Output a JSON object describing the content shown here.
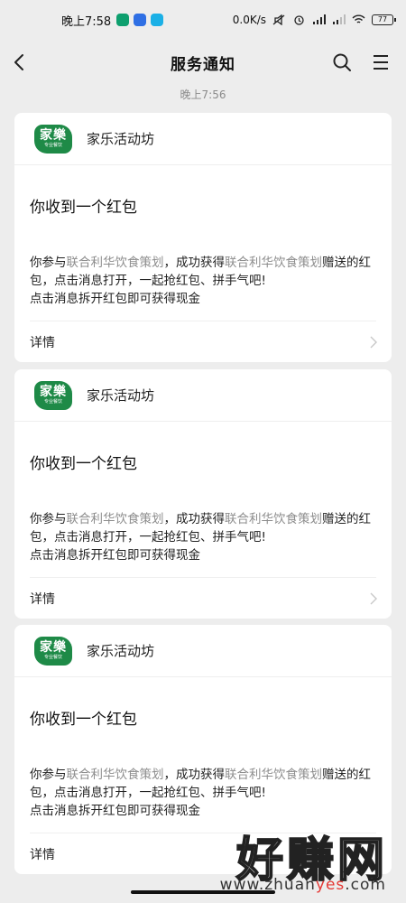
{
  "status_bar": {
    "time": "晚上7:58",
    "network_speed": "0.0K/s",
    "battery": "77",
    "app_icon_colors": [
      "#0e9f6e",
      "#2f6fe4",
      "#1bb0e6"
    ]
  },
  "nav": {
    "title": "服务通知",
    "back_icon": "chevron-left-icon",
    "search_icon": "search-icon",
    "menu_icon": "menu-icon"
  },
  "timestamp": "晚上7:56",
  "cards": [
    {
      "logo_main": "家樂",
      "logo_sub": "专业餐饮",
      "sender": "家乐活动坊",
      "title": "你收到一个红包",
      "body_prefix": "你参与",
      "body_link1": "联合利华饮食策划",
      "body_mid": "，成功获得",
      "body_link2": "联合利华饮食策划",
      "body_suffix": "赠送的红包，点击消息打开，一起抢红包、拼手气吧!",
      "body_line2": "点击消息拆开红包即可获得现金",
      "detail": "详情"
    },
    {
      "logo_main": "家樂",
      "logo_sub": "专业餐饮",
      "sender": "家乐活动坊",
      "title": "你收到一个红包",
      "body_prefix": "你参与",
      "body_link1": "联合利华饮食策划",
      "body_mid": "，成功获得",
      "body_link2": "联合利华饮食策划",
      "body_suffix": "赠送的红包，点击消息打开，一起抢红包、拼手气吧!",
      "body_line2": "点击消息拆开红包即可获得现金",
      "detail": "详情"
    },
    {
      "logo_main": "家樂",
      "logo_sub": "专业餐饮",
      "sender": "家乐活动坊",
      "title": "你收到一个红包",
      "body_prefix": "你参与",
      "body_link1": "联合利华饮食策划",
      "body_mid": "，成功获得",
      "body_link2": "联合利华饮食策划",
      "body_suffix": "赠送的红包，点击消息打开，一起抢红包、拼手气吧!",
      "body_line2": "点击消息拆开红包即可获得现金",
      "detail": "详情"
    }
  ],
  "watermark": {
    "text": "好赚网",
    "url_prefix": "www.zhuan",
    "url_highlight": "yes",
    "url_suffix": ".com"
  },
  "colors": {
    "background": "#ededed",
    "card": "#ffffff",
    "brand_green": "#1e8a47",
    "link_gray": "#8d8d8d"
  }
}
